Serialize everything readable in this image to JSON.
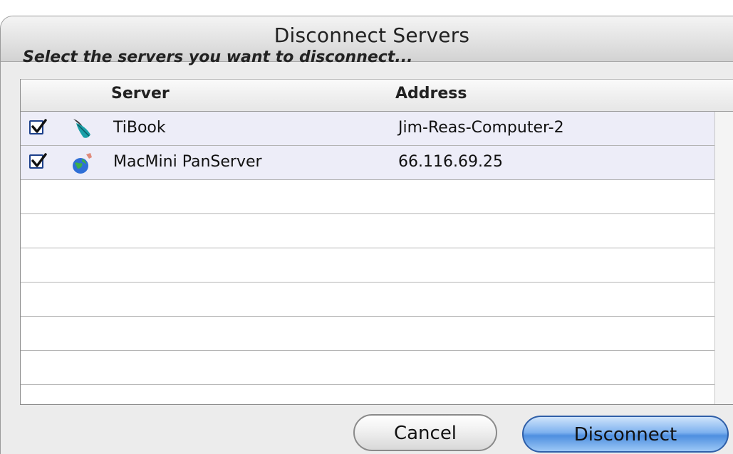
{
  "dialog": {
    "title": "Disconnect Servers",
    "prompt": "Select the servers you want to disconnect..."
  },
  "table": {
    "columns": [
      "Server",
      "Address"
    ],
    "rows": [
      {
        "checked": true,
        "icon": "feather-icon",
        "server": "TiBook",
        "address": "Jim-Reas-Computer-2"
      },
      {
        "checked": true,
        "icon": "globe-icon",
        "server": "MacMini PanServer",
        "address": "66.116.69.25"
      }
    ]
  },
  "buttons": {
    "cancel": "Cancel",
    "disconnect": "Disconnect"
  },
  "colors": {
    "accent": "#4e8fe0",
    "checkbox": "#1b3f8a",
    "alt_row": "#ededf8"
  }
}
